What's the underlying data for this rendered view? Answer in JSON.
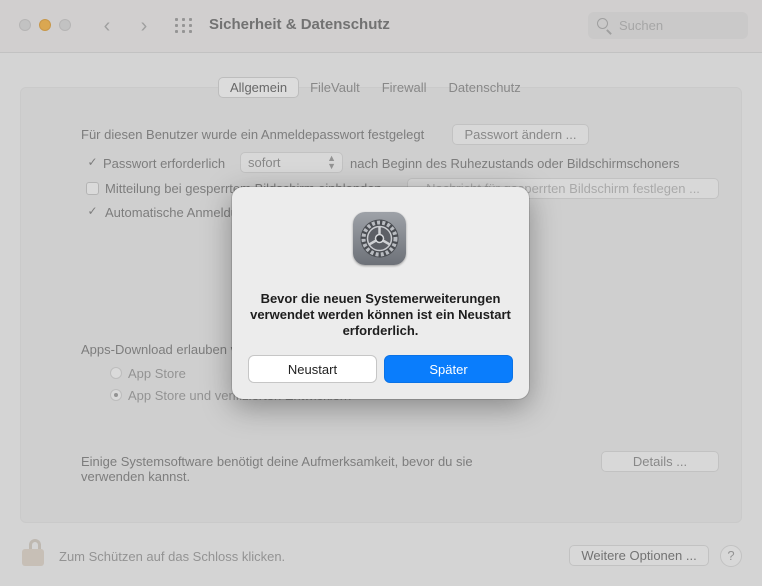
{
  "window": {
    "title": "Sicherheit & Datenschutz",
    "search_placeholder": "Suchen"
  },
  "tabs": [
    {
      "label": "Allgemein",
      "active": true
    },
    {
      "label": "FileVault",
      "active": false
    },
    {
      "label": "Firewall",
      "active": false
    },
    {
      "label": "Datenschutz",
      "active": false
    }
  ],
  "general": {
    "login_password_text": "Für diesen Benutzer wurde ein Anmeldepasswort festgelegt",
    "change_password_button": "Passwort ändern ...",
    "require_password_label": "Passwort erforderlich",
    "require_password_checked": true,
    "require_password_value": "sofort",
    "require_password_suffix": "nach Beginn des Ruhezustands oder Bildschirmschoners",
    "show_message_label": "Mitteilung bei gesperrtem Bildschirm einblenden",
    "show_message_checked": false,
    "set_lock_message_button": "Nachricht für gesperrten Bildschirm festlegen ...",
    "auto_login_label": "Automatische Anmeldung deaktivieren",
    "auto_login_checked": true
  },
  "downloads": {
    "label": "Apps-Download erlauben von:",
    "options": [
      {
        "label": "App Store",
        "selected": false
      },
      {
        "label": "App Store und verifizierten Entwicklern",
        "selected": true
      }
    ]
  },
  "system_software": {
    "text_line1": "Einige Systemsoftware benötigt deine Aufmerksamkeit, bevor du sie",
    "text_line2": "verwenden kannst.",
    "details_button": "Details ..."
  },
  "footer": {
    "lock_text": "Zum Schützen auf das Schloss klicken.",
    "advanced_button": "Weitere Optionen ...",
    "help_label": "?"
  },
  "dialog": {
    "icon": "system-preferences-gear-icon",
    "message": "Bevor die neuen Systemerweiterungen verwendet werden können ist ein Neustart erforderlich.",
    "restart_button": "Neustart",
    "later_button": "Später"
  },
  "colors": {
    "accent": "#0a7dfc",
    "minimize_light": "#f5a623"
  }
}
